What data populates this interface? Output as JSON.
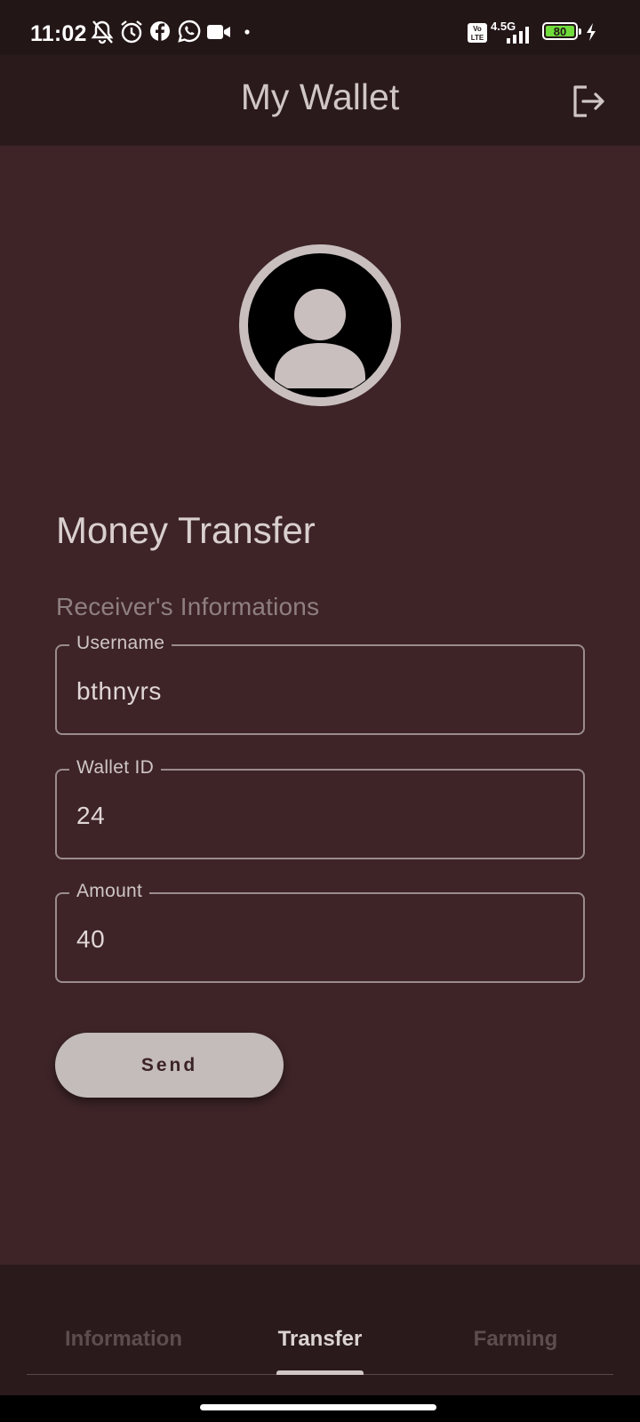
{
  "status_bar": {
    "time": "11:02",
    "network": "4.5G",
    "battery": "80",
    "icons": [
      "bell-off-icon",
      "alarm-icon",
      "facebook-icon",
      "whatsapp-icon",
      "video-camera-icon",
      "dot-icon",
      "volte-icon",
      "signal-icon",
      "battery-icon",
      "charging-icon"
    ]
  },
  "app_bar": {
    "title": "My Wallet",
    "action_icon": "logout-icon"
  },
  "profile": {
    "avatar_icon": "person-icon"
  },
  "transfer": {
    "title": "Money Transfer",
    "subtitle": "Receiver's Informations",
    "fields": [
      {
        "label": "Username",
        "value": "bthnyrs"
      },
      {
        "label": "Wallet ID",
        "value": "24"
      },
      {
        "label": "Amount",
        "value": "40"
      }
    ],
    "send_label": "Send"
  },
  "bottom_nav": {
    "tabs": [
      {
        "label": "Information",
        "active": false
      },
      {
        "label": "Transfer",
        "active": true
      },
      {
        "label": "Farming",
        "active": false
      }
    ]
  },
  "colors": {
    "background": "#3e2427",
    "app_bar": "#2a1a1b",
    "status_bar": "#231617",
    "button": "#c4bbbb",
    "battery_fill": "#6fdc3c"
  }
}
